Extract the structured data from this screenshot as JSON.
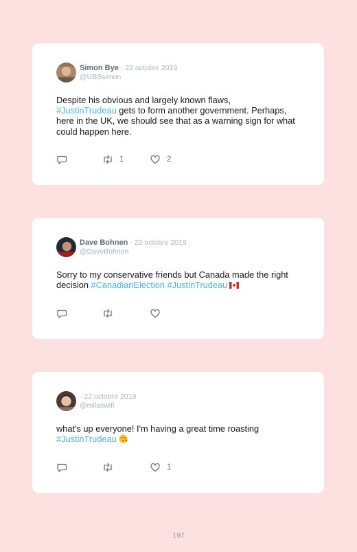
{
  "tweets": [
    {
      "name": "Simon Bye",
      "date": "· 22 octobre 2019",
      "handle": "@UBSsimon",
      "text_before": "Despite his obvious and largely known flaws,",
      "hashtag1": "#JustinTrudeau",
      "text_after": " gets to form another government. Perhaps, here in the UK, we should see that as a warning sign for what could happen here.",
      "retweets": "1",
      "likes": "2"
    },
    {
      "name": "Dave Bohnen",
      "date": "· 22 octobre 2019",
      "handle": "@DaveBohnen",
      "text_before": "Sorry to my conservative friends but Canada made the right decision ",
      "hashtag1": "#CanadianElection",
      "hashtag2": "#JustinTrudeau",
      "emoji": "canada-flag",
      "retweets": "",
      "likes": ""
    },
    {
      "name": "",
      "date": "· 22 octobre 2019",
      "handle": "@milaswifi",
      "text_before": "what's up everyone! I'm having a great time roasting",
      "hashtag1": "#JustinTrudeau",
      "emoji": "face-blowing-a-kiss",
      "retweets": "",
      "likes": "1"
    }
  ],
  "page_number": "197",
  "colors": {
    "background": "#fde1e1",
    "card": "#ffffff",
    "hashtag": "#4ab3e8",
    "icon": "#657786"
  }
}
